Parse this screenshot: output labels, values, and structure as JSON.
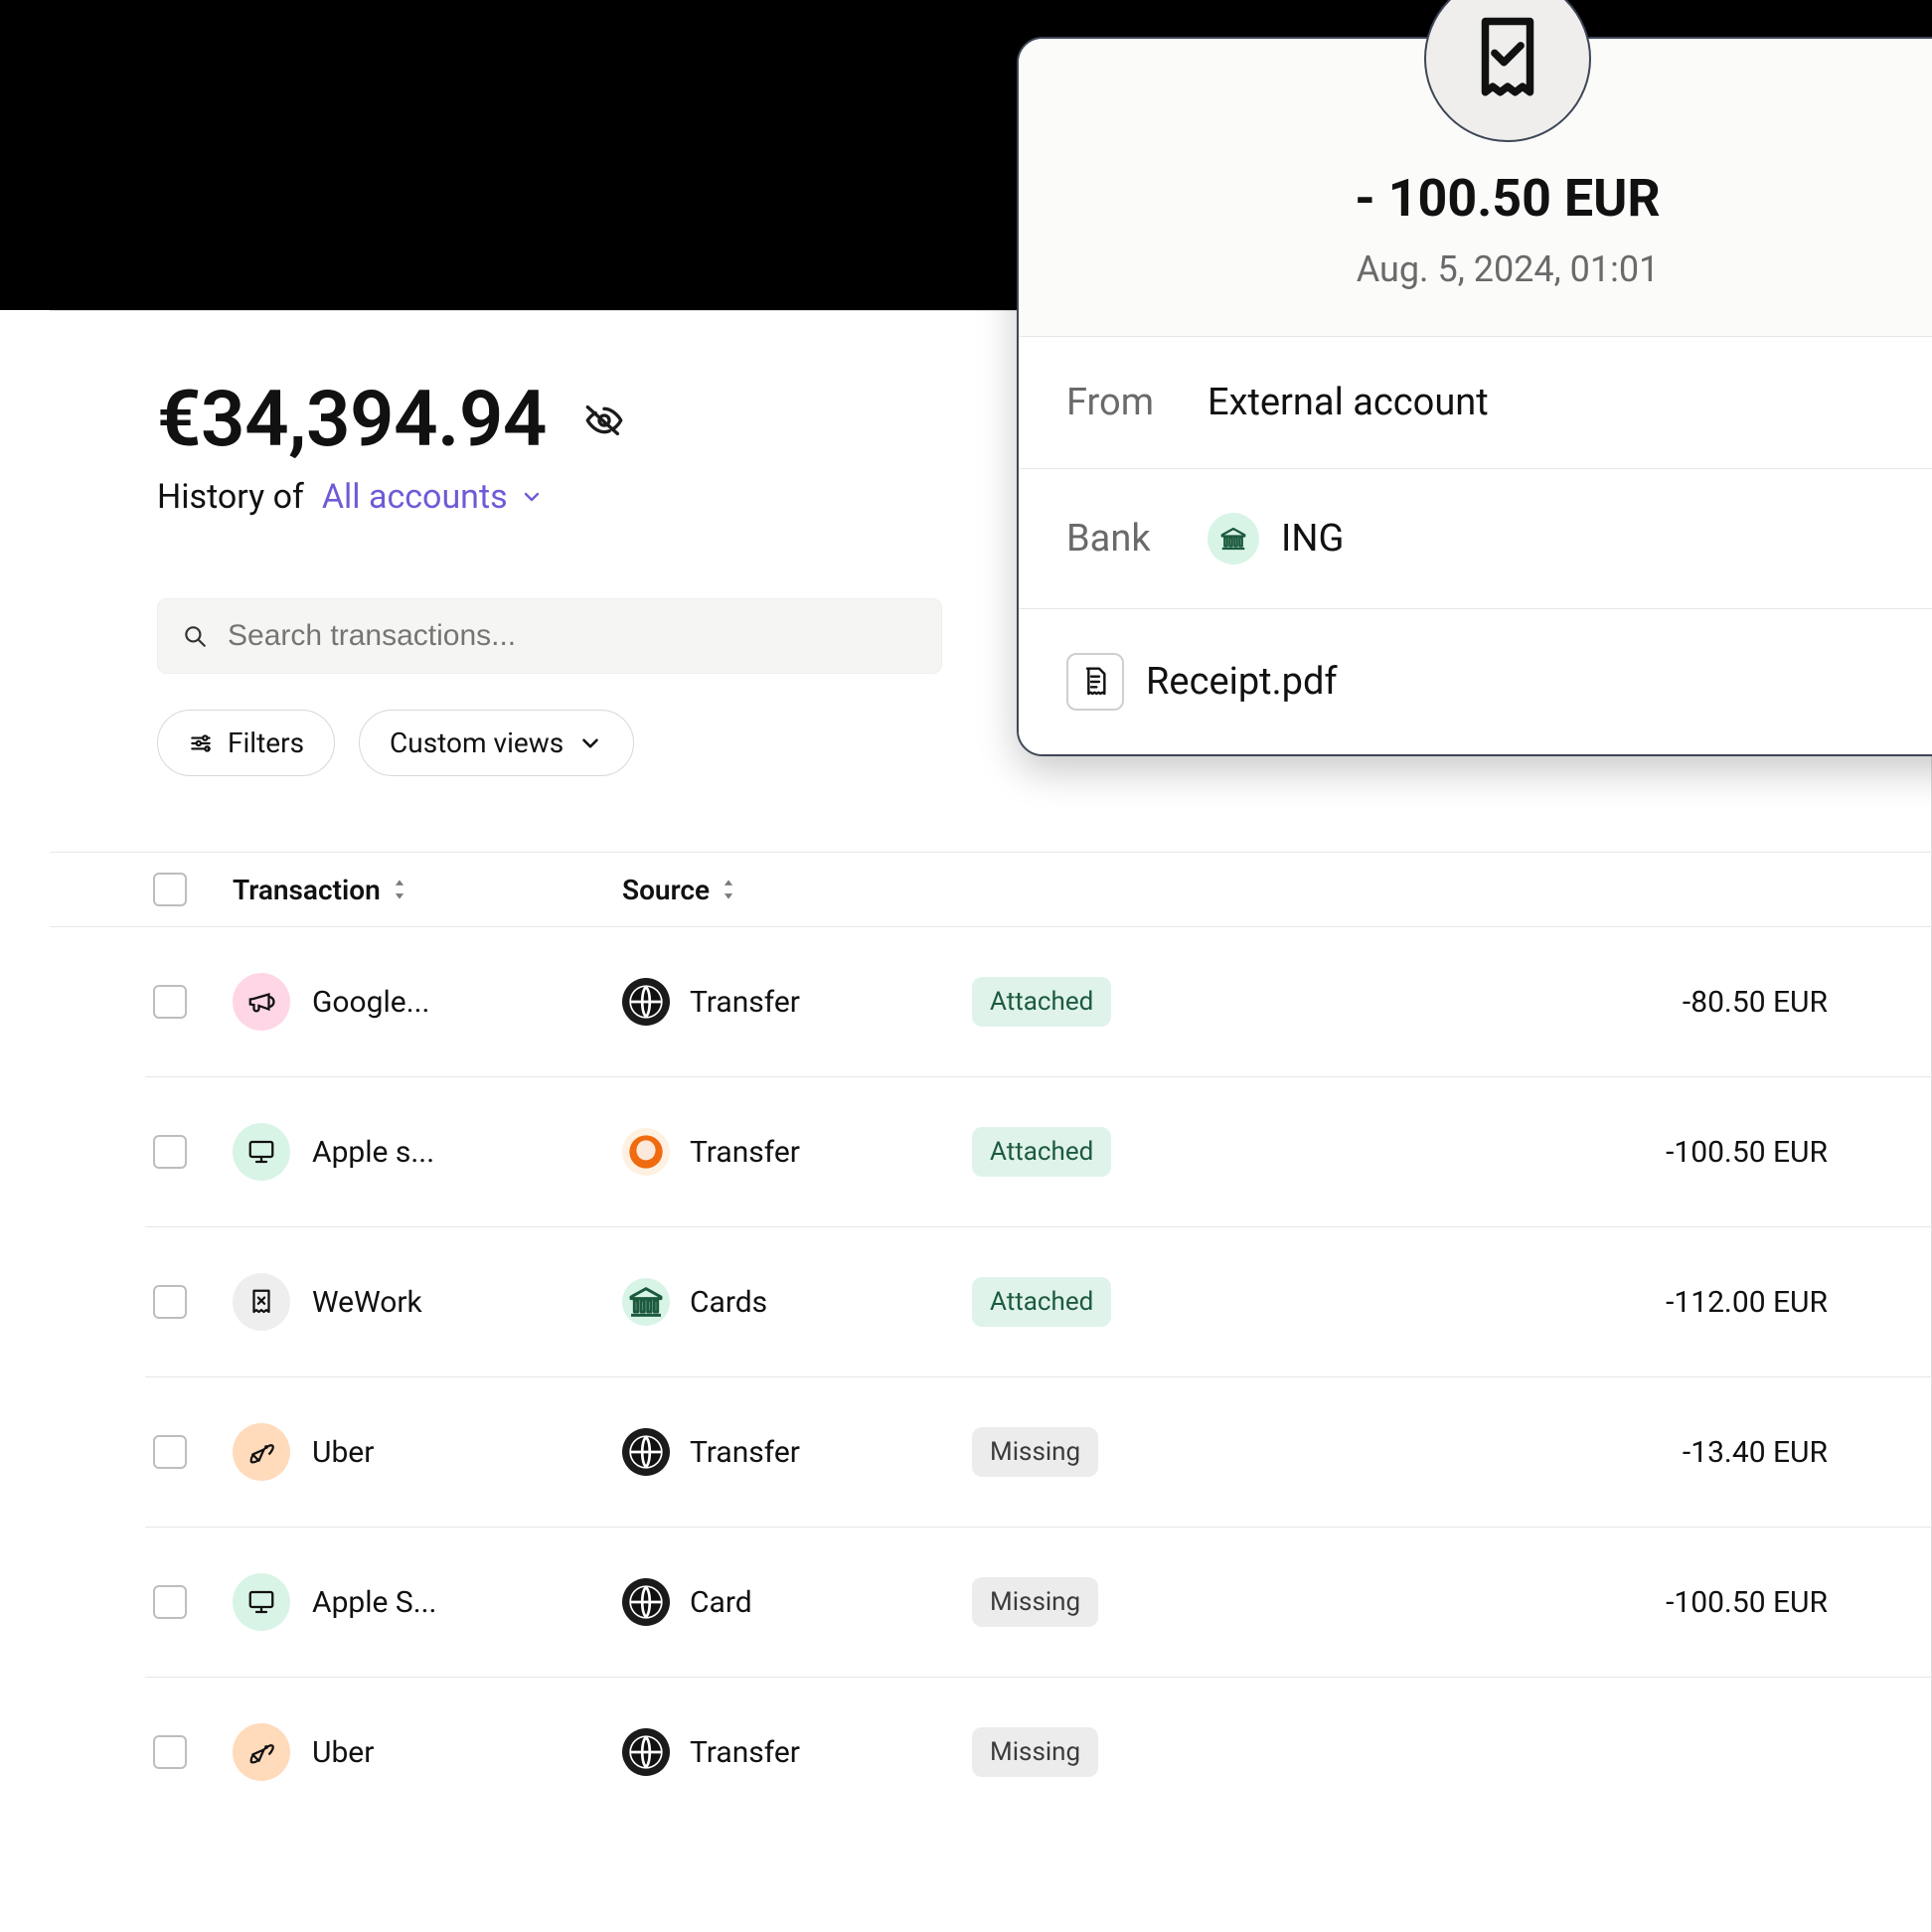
{
  "header": {
    "balance": "€34,394.94",
    "history_label": "History of",
    "accounts_selector": "All accounts"
  },
  "search": {
    "placeholder": "Search transactions..."
  },
  "toolbar": {
    "filters_label": "Filters",
    "custom_views_label": "Custom views"
  },
  "table": {
    "columns": {
      "transaction": "Transaction",
      "source": "Source",
      "receipt": "",
      "amount": ""
    },
    "rows": [
      {
        "merchant": "Google...",
        "source_label": "Transfer",
        "receipt": "Attached",
        "amount": "-80.50 EUR",
        "cat_icon": "megaphone-icon",
        "cat_color": "pink",
        "src_icon": "globe-icon",
        "src_style": "dark"
      },
      {
        "merchant": "Apple s...",
        "source_label": "Transfer",
        "receipt": "Attached",
        "amount": "-100.50 EUR",
        "cat_icon": "monitor-icon",
        "cat_color": "mint",
        "src_icon": "lion-icon",
        "src_style": "orange"
      },
      {
        "merchant": "WeWork",
        "source_label": "Cards",
        "receipt": "Attached",
        "amount": "-112.00 EUR",
        "cat_icon": "receipt-x-icon",
        "cat_color": "grey",
        "src_icon": "bank-icon",
        "src_style": "mint"
      },
      {
        "merchant": "Uber",
        "source_label": "Transfer",
        "receipt": "Missing",
        "amount": "-13.40 EUR",
        "cat_icon": "rocket-icon",
        "cat_color": "peach",
        "src_icon": "globe-icon",
        "src_style": "dark"
      },
      {
        "merchant": "Apple S...",
        "source_label": "Card",
        "receipt": "Missing",
        "amount": "-100.50 EUR",
        "cat_icon": "monitor-icon",
        "cat_color": "mint",
        "src_icon": "globe-icon",
        "src_style": "dark"
      },
      {
        "merchant": "Uber",
        "source_label": "Transfer",
        "receipt": "Missing",
        "amount": "",
        "cat_icon": "rocket-icon",
        "cat_color": "peach",
        "src_icon": "globe-icon",
        "src_style": "dark"
      }
    ]
  },
  "detail": {
    "amount": "- 100.50 EUR",
    "date": "Aug. 5, 2024, 01:01",
    "from_label": "From",
    "from_value": "External account",
    "bank_label": "Bank",
    "bank_name": "ING",
    "attachment_name": "Receipt.pdf"
  },
  "colors": {
    "accent": "#6f5bd6",
    "badge_attached": "#dff3eb",
    "badge_missing": "#ececec"
  }
}
